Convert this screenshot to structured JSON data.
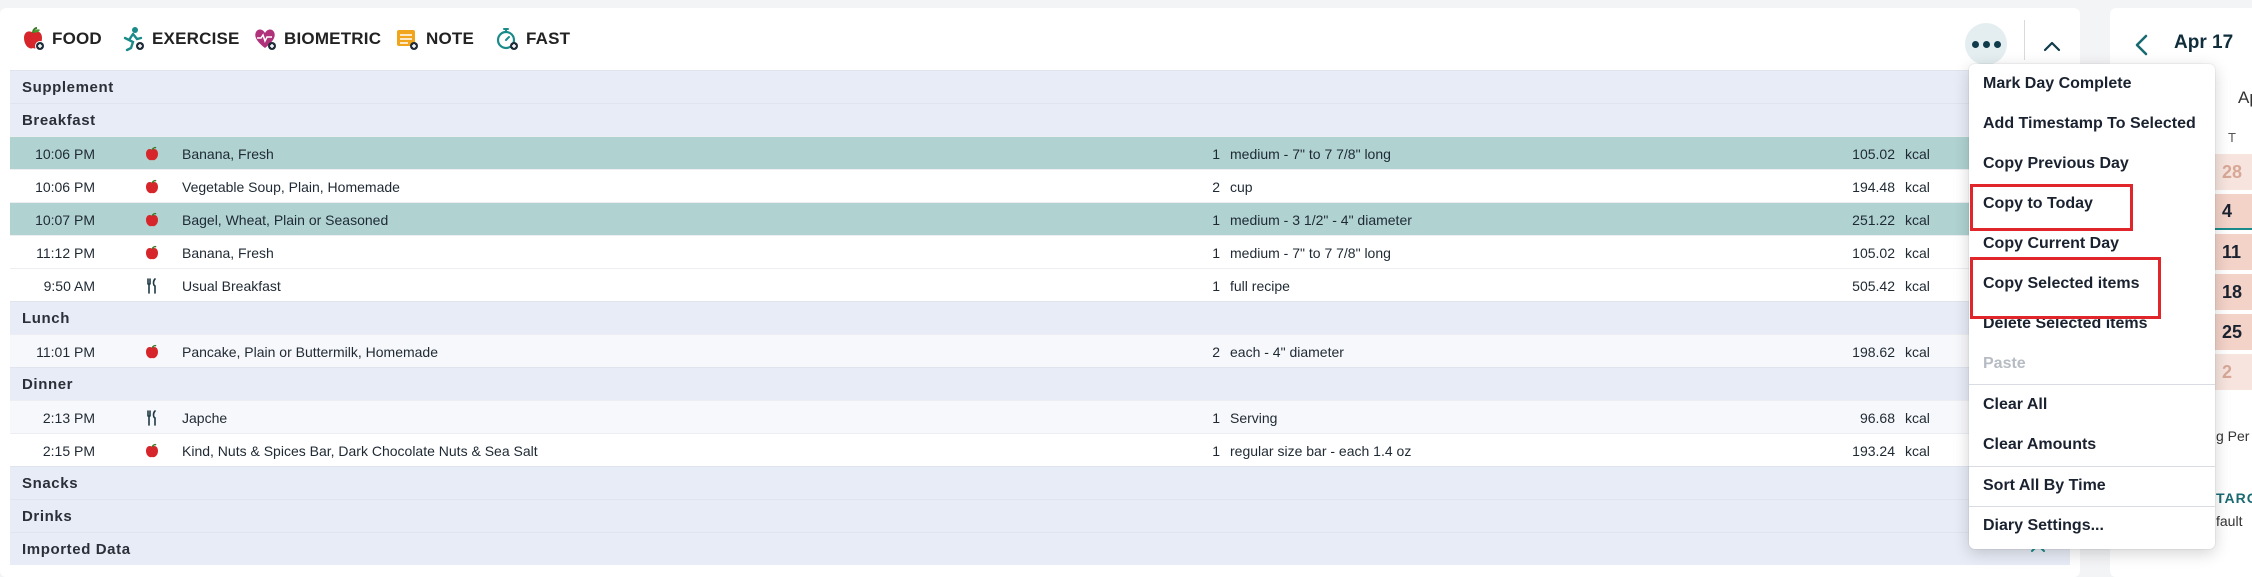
{
  "toolbar": {
    "food": "FOOD",
    "exercise": "EXERCISE",
    "biometric": "BIOMETRIC",
    "note": "NOTE",
    "fast": "FAST"
  },
  "diary": {
    "supplement": "Supplement",
    "breakfast": {
      "label": "Breakfast",
      "rows": [
        {
          "time": "10:06 PM",
          "icon": "apple-icon",
          "desc": "Banana, Fresh",
          "amount": "1",
          "unit": "medium - 7\" to 7 7/8\" long",
          "cal": "105.02",
          "kcal": "kcal",
          "selected": true
        },
        {
          "time": "10:06 PM",
          "icon": "apple-icon",
          "desc": "Vegetable Soup, Plain, Homemade",
          "amount": "2",
          "unit": "cup",
          "cal": "194.48",
          "kcal": "kcal",
          "selected": false
        },
        {
          "time": "10:07 PM",
          "icon": "apple-icon",
          "desc": "Bagel, Wheat, Plain or Seasoned",
          "amount": "1",
          "unit": "medium - 3 1/2\" - 4\" diameter",
          "cal": "251.22",
          "kcal": "kcal",
          "selected": true
        },
        {
          "time": "11:12 PM",
          "icon": "apple-icon",
          "desc": "Banana, Fresh",
          "amount": "1",
          "unit": "medium - 7\" to 7 7/8\" long",
          "cal": "105.02",
          "kcal": "kcal",
          "selected": false
        },
        {
          "time": "9:50 AM",
          "icon": "fork-knife-icon",
          "desc": "Usual Breakfast",
          "amount": "1",
          "unit": "full recipe",
          "cal": "505.42",
          "kcal": "kcal",
          "selected": false
        }
      ]
    },
    "lunch": {
      "label": "Lunch",
      "rows": [
        {
          "time": "11:01 PM",
          "icon": "apple-icon",
          "desc": "Pancake, Plain or Buttermilk, Homemade",
          "amount": "2",
          "unit": "each - 4\" diameter",
          "cal": "198.62",
          "kcal": "kcal"
        }
      ]
    },
    "dinner": {
      "label": "Dinner",
      "rows": [
        {
          "time": "2:13 PM",
          "icon": "fork-knife-icon",
          "desc": "Japche",
          "amount": "1",
          "unit": "Serving",
          "cal": "96.68",
          "kcal": "kcal"
        },
        {
          "time": "2:15 PM",
          "icon": "apple-icon",
          "desc": "Kind, Nuts & Spices Bar, Dark Chocolate Nuts & Sea Salt",
          "amount": "1",
          "unit": "regular size bar - each 1.4 oz",
          "cal": "193.24",
          "kcal": "kcal"
        }
      ]
    },
    "snacks": "Snacks",
    "drinks": "Drinks",
    "imported": "Imported Data"
  },
  "menu": {
    "items": [
      {
        "label": "Mark Day Complete"
      },
      {
        "label": "Add Timestamp To Selected"
      },
      {
        "label": "Copy Previous Day"
      },
      {
        "label": "Copy to Today",
        "highlighted": true
      },
      {
        "label": "Copy Current Day"
      },
      {
        "label": "Copy Selected items",
        "highlighted": true
      },
      {
        "label": "Delete Selected items"
      },
      {
        "label": "Paste",
        "disabled": true
      },
      {
        "label": "Clear All"
      },
      {
        "label": "Clear Amounts"
      },
      {
        "label": "Sort All By Time"
      },
      {
        "label": "Diary Settings..."
      }
    ]
  },
  "calendar": {
    "date": "Apr 17",
    "month_fragment": "Ap",
    "dow": "T",
    "days": [
      {
        "num": "28",
        "status": "faded"
      },
      {
        "num": "4",
        "status": "complete"
      },
      {
        "num": "11",
        "status": "complete"
      },
      {
        "num": "18",
        "status": "complete"
      },
      {
        "num": "25",
        "status": "complete"
      },
      {
        "num": "2",
        "status": "faded"
      }
    ],
    "note1": "g Per",
    "note2": "TARG",
    "note3": "fault"
  },
  "colors": {
    "selected_row": "#b0d3d2",
    "section_bg": "#e8ecf6",
    "accent": "#0f5a5e",
    "highlight_box": "#e0262a",
    "calendar_day_bg": "#f3d2c8"
  }
}
